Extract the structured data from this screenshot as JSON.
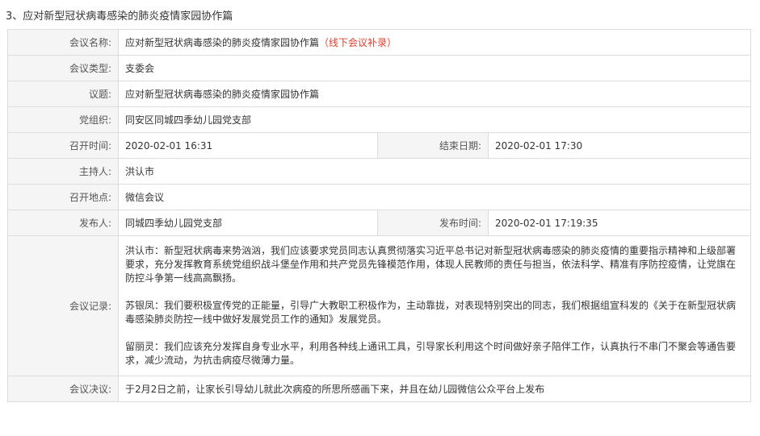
{
  "heading": "3、应对新型冠状病毒感染的肺炎疫情家园协作篇",
  "rows": {
    "name": {
      "label": "会议名称:",
      "value": "应对新型冠状病毒感染的肺炎疫情家园协作篇",
      "note": "（线下会议补录）"
    },
    "type": {
      "label": "会议类型:",
      "value": "支委会"
    },
    "topic": {
      "label": "议题:",
      "value": "应对新型冠状病毒感染的肺炎疫情家园协作篇"
    },
    "org": {
      "label": "党组织:",
      "value": "同安区同城四季幼儿园党支部"
    },
    "start": {
      "label": "召开时间:",
      "value": "2020-02-01 16:31"
    },
    "end": {
      "label": "结束日期:",
      "value": "2020-02-01 17:30"
    },
    "host": {
      "label": "主持人:",
      "value": "洪认市"
    },
    "place": {
      "label": "召开地点:",
      "value": "微信会议"
    },
    "publisher": {
      "label": "发布人:",
      "value": "同城四季幼儿园党支部"
    },
    "pubtime": {
      "label": "发布时间:",
      "value": "2020-02-01 17:19:35"
    },
    "record": {
      "label": "会议记录:",
      "paragraphs": [
        "洪认市：新型冠状病毒来势汹汹，我们应该要求党员同志认真贯彻落实习近平总书记对新型冠状病毒感染的肺炎疫情的重要指示精神和上级部署要求，充分发挥教育系统党组织战斗堡垒作用和共产党员先锋模范作用，体现人民教师的责任与担当，依法科学、精准有序防控疫情，让党旗在防控斗争第一线高高飘扬。",
        "苏银凤：我们要积极宣传党的正能量，引导广大教职工积极作为，主动靠拢，对表现特别突出的同志，我们根据组宣科发的《关于在新型冠状病毒感染肺炎防控一线中做好发展党员工作的通知》发展党员。",
        "留丽灵：我们应该充分发挥自身专业水平，利用各种线上通讯工具，引导家长利用这个时间做好亲子陪伴工作，认真执行不串门不聚会等通告要求，减少流动，为抗击病疫尽微薄力量。"
      ]
    },
    "resolution": {
      "label": "会议决议:",
      "value": "于2月2日之前，让家长引导幼儿就此次病疫的所思所感画下来，并且在幼儿园微信公众平台上发布"
    }
  }
}
